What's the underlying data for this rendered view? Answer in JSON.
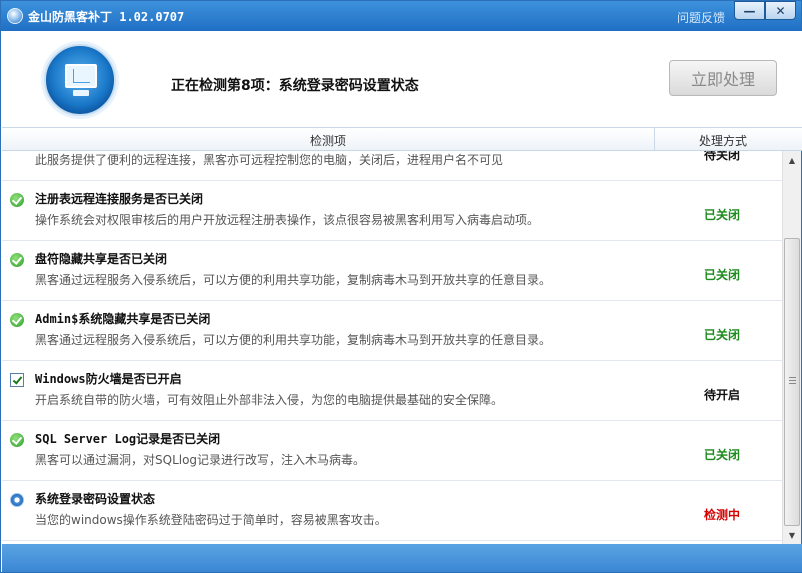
{
  "window": {
    "title": "金山防黑客补丁 1.02.0707",
    "feedback_link": "问题反馈",
    "minimize_glyph": "—",
    "close_glyph": "✕"
  },
  "header": {
    "status": "正在检测第8项：系统登录密码设置状态",
    "action_button": "立即处理"
  },
  "columns": {
    "item": "检测项",
    "action": "处理方式"
  },
  "rows": [
    {
      "icon": "none",
      "title": "",
      "desc": "此服务提供了便利的远程连接，黑客亦可远程控制您的电脑，关闭后，进程用户名不可见",
      "status": "待关闭",
      "status_color": "#111111"
    },
    {
      "icon": "ok-icon",
      "title": "注册表远程连接服务是否已关闭",
      "desc": "操作系统会对权限审核后的用户开放远程注册表操作，该点很容易被黑客利用写入病毒启动项。",
      "status": "已关闭",
      "status_color": "#1c8a1c"
    },
    {
      "icon": "ok-icon",
      "title": "盘符隐藏共享是否已关闭",
      "desc": "黑客通过远程服务入侵系统后，可以方便的利用共享功能，复制病毒木马到开放共享的任意目录。",
      "status": "已关闭",
      "status_color": "#1c8a1c"
    },
    {
      "icon": "ok-icon",
      "title": "Admin$系统隐藏共享是否已关闭",
      "desc": "黑客通过远程服务入侵系统后，可以方便的利用共享功能，复制病毒木马到开放共享的任意目录。",
      "status": "已关闭",
      "status_color": "#1c8a1c"
    },
    {
      "icon": "checkbox-icon",
      "title": "Windows防火墙是否已开启",
      "desc": "开启系统自带的防火墙，可有效阻止外部非法入侵，为您的电脑提供最基础的安全保障。",
      "status": "待开启",
      "status_color": "#111111"
    },
    {
      "icon": "ok-icon",
      "title": "SQL Server Log记录是否已关闭",
      "desc": "黑客可以通过漏洞，对SQLlog记录进行改写，注入木马病毒。",
      "status": "已关闭",
      "status_color": "#1c8a1c"
    },
    {
      "icon": "scanning-icon",
      "title": "系统登录密码设置状态",
      "desc": "当您的windows操作系统登陆密码过于简单时，容易被黑客攻击。",
      "status": "检测中",
      "status_color": "#d40000"
    }
  ],
  "scrollbar": {
    "up_glyph": "▲",
    "down_glyph": "▼"
  }
}
